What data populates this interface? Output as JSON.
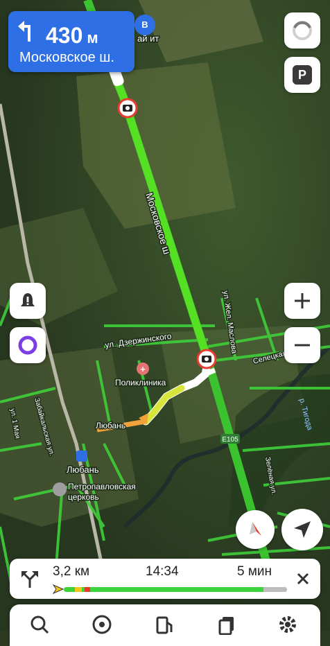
{
  "maneuver": {
    "distance": "430",
    "unit": "м",
    "street": "Московское ш."
  },
  "waypoint": {
    "label": "B"
  },
  "map_labels": {
    "top_partial": "ай ит",
    "highway": "Московское ш",
    "dzerzhinsky": "ул. Дзержинского",
    "polyclinic": "Поликлиника",
    "luban_station": "Любань",
    "luban": "Любань",
    "church_line1": "Петропавловская",
    "church_line2": "церковь",
    "zhelez": "ул. Жел. Маслова",
    "selesk": "Селецкая",
    "e105": "E105",
    "river": "р. Тигода",
    "zabaikal": "Забайкальская ул.",
    "may1": "ул. 1 Мая",
    "zelen": "Зелёная ул."
  },
  "route_panel": {
    "distance": "3,2 км",
    "arrival_time": "14:34",
    "duration": "5 мин"
  },
  "progress": {
    "traveled_fraction": 0.03
  },
  "colors": {
    "route_green": "#55e023",
    "accent_blue": "#2f6fe6",
    "traffic_yellow": "#f5c518",
    "traffic_red": "#e63b2e"
  },
  "icons": [
    "turn-left-icon",
    "loading-spinner-icon",
    "parking-icon",
    "alert-icon",
    "alice-icon",
    "zoom-in-icon",
    "zoom-out-icon",
    "compass-icon",
    "locate-icon",
    "alternate-route-icon",
    "close-icon",
    "search-icon",
    "music-icon",
    "fuel-icon",
    "copy-icon",
    "settings-icon",
    "speed-camera-icon"
  ]
}
